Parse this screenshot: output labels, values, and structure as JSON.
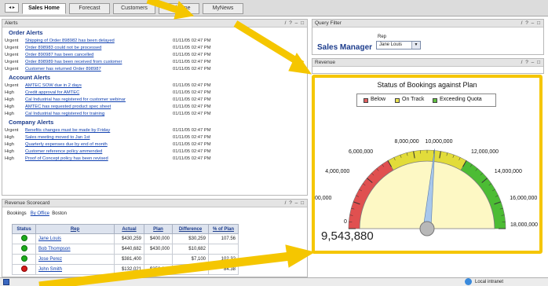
{
  "tabs": [
    {
      "label": "Sales Home",
      "active": true
    },
    {
      "label": "Forecast"
    },
    {
      "label": "Customers"
    },
    {
      "label": "Welcome"
    },
    {
      "label": "MyNews"
    }
  ],
  "alerts": {
    "title": "Alerts",
    "controls": "/ ? – □",
    "sections": [
      {
        "heading": "Order Alerts",
        "rows": [
          {
            "priority": "Urgent",
            "message": "Shipping of Order 898982 has been delayed",
            "time": "01/11/05 02:47 PM"
          },
          {
            "priority": "Urgent",
            "message": "Order 898983 could not be processed",
            "time": "01/11/05 02:47 PM"
          },
          {
            "priority": "Urgent",
            "message": "Order 890987 has been cancelled",
            "time": "01/11/05 02:47 PM"
          },
          {
            "priority": "Urgent",
            "message": "Order 898989 has been received from customer",
            "time": "01/11/05 02:47 PM"
          },
          {
            "priority": "Urgent",
            "message": "Customer has returned Order 898987",
            "time": "01/11/05 02:47 PM"
          }
        ]
      },
      {
        "heading": "Account Alerts",
        "rows": [
          {
            "priority": "Urgent",
            "message": "AMTEC SOW due in 2 days",
            "time": "01/11/05 02:47 PM"
          },
          {
            "priority": "High",
            "message": "Credit approval for AMTEC",
            "time": "01/11/05 02:47 PM"
          },
          {
            "priority": "High",
            "message": "Cal Industrial has registered for customer webinar",
            "time": "01/11/05 02:47 PM"
          },
          {
            "priority": "High",
            "message": "AMTEC has requested product spec sheet",
            "time": "01/11/05 02:47 PM"
          },
          {
            "priority": "High",
            "message": "Cal Industrial has registered for training",
            "time": "01/11/05 02:47 PM"
          }
        ]
      },
      {
        "heading": "Company Alerts",
        "rows": [
          {
            "priority": "Urgent",
            "message": "Benefits changes must be made by Friday",
            "time": "01/11/05 02:47 PM"
          },
          {
            "priority": "High",
            "message": "Sales meeting moved to Jan 1st",
            "time": "01/11/05 02:47 PM"
          },
          {
            "priority": "High",
            "message": "Quarterly expenses due by end of month",
            "time": "01/11/05 02:47 PM"
          },
          {
            "priority": "High",
            "message": "Customer reference policy ammended",
            "time": "01/11/05 02:47 PM"
          },
          {
            "priority": "High",
            "message": "Proof of Concept policy has been revised",
            "time": "01/11/05 02:47 PM"
          }
        ]
      }
    ]
  },
  "query_filter": {
    "title": "Query Filter",
    "controls": "/ ? – □",
    "label": "Sales Manager",
    "rep_label": "Rep",
    "rep_value": "Jane Louis"
  },
  "revenue": {
    "title": "Revenue",
    "controls": "/ ? – □",
    "chart_title": "Status of Bookings against Plan",
    "readout": "9,543,880",
    "legend": [
      {
        "label": "Below",
        "color": "#e06060"
      },
      {
        "label": "On Track",
        "color": "#e8e050"
      },
      {
        "label": "Exceeding Quota",
        "color": "#60c040"
      }
    ]
  },
  "chart_data": {
    "type": "gauge",
    "title": "Status of Bookings against Plan",
    "value": 9543880,
    "min": 0,
    "max": 18000000,
    "ticks": [
      "0",
      "00,000",
      "4,000,000",
      "6,000,000",
      "8,000,000",
      "10,000,000",
      "12,000,000",
      "14,000,000",
      "16,000,000",
      "18,000,000"
    ],
    "tick_values": [
      0,
      2000000,
      4000000,
      6000000,
      8000000,
      10000000,
      12000000,
      14000000,
      16000000,
      18000000
    ],
    "bands": [
      {
        "name": "Below",
        "from": 0,
        "to": 6000000,
        "color": "#e05050"
      },
      {
        "name": "On Track",
        "from": 6000000,
        "to": 12000000,
        "color": "#e2dc3a"
      },
      {
        "name": "Exceeding Quota",
        "from": 12000000,
        "to": 18000000,
        "color": "#4cbc34"
      }
    ]
  },
  "scorecard": {
    "title": "Revenue Scorecard",
    "controls": "/ ? – □",
    "bookings_label": "Bookings",
    "by_office": "By Office",
    "location": "Boston",
    "columns": [
      "Status",
      "Rep",
      "Actual",
      "Plan",
      "Difference",
      "% of Plan"
    ],
    "rows": [
      {
        "status": "green",
        "rep": "Jane Louis",
        "actual": "$430,259",
        "plan": "$400,000",
        "difference": "$30,259",
        "pct": "107.56"
      },
      {
        "status": "green",
        "rep": "Bob Thompson",
        "actual": "$440,682",
        "plan": "$430,000",
        "difference": "$10,682",
        "pct": ""
      },
      {
        "status": "green",
        "rep": "Jose Perez",
        "actual": "$381,400",
        "plan": "",
        "difference": "$7,100",
        "pct": "102.32"
      },
      {
        "status": "red",
        "rep": "John Smith",
        "actual": "$132,021",
        "plan": "$352,000",
        "difference": "$116,760",
        "pct": "84.38"
      }
    ]
  },
  "statusbar": {
    "zone": "Local intranet"
  }
}
